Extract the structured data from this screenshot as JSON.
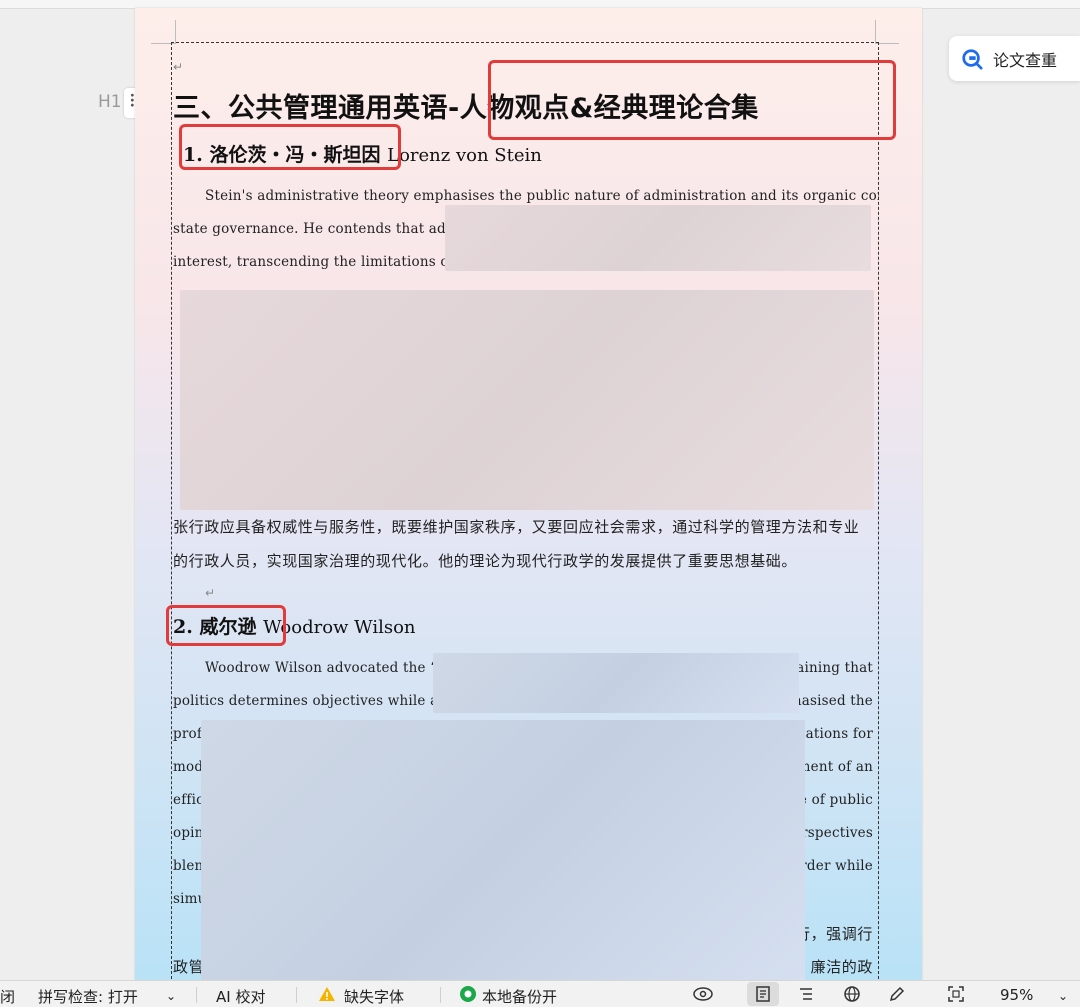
{
  "document": {
    "title": "三、公共管理通用英语-人物观点&经典理论合集",
    "section1": {
      "num": "1.",
      "name_cn": "洛伦茨・冯・斯坦因",
      "name_en": "Lorenz von Stein",
      "lines": [
        "Stein's administrative theory emphasises the public nature of administration and its organic connection to",
        "state governance. He contends that adminis",
        "interest, transcending the limitations of the"
      ],
      "cn_lines": [
        "张行政应具备权威性与服务性，既要维护国家秩序，又要回应社会需求，通过科学的管理方法和专业",
        "的行政人员，实现国家治理的现代化。他的理论为现代行政学的发展提供了重要思想基础。"
      ]
    },
    "section2": {
      "num": "2.",
      "name_cn": "威尔逊",
      "name_en": "Woodrow Wilson",
      "lines_left": [
        "Woodrow Wilson advocated the  ‘s",
        "politics determines objectives while ad",
        "prof",
        "mod",
        "effic",
        "opin",
        "blen",
        "simu"
      ],
      "lines_right": [
        "ntaining that",
        "hasised the",
        "ndations for",
        "ment of an",
        "le of public",
        "erspectives",
        "rder while",
        ""
      ],
      "cn_tail_right": "行，强调行",
      "cn_bottom_left": "政管",
      "cn_bottom_right": "廉洁的政"
    }
  },
  "sidebar": {
    "heading_marker": "H1",
    "check_button": "论文查重"
  },
  "status_bar": {
    "close_fragment": "闭",
    "spell_check": "拼写检查: 打开",
    "ai_proofread": "AI 校对",
    "missing_fonts": "缺失字体",
    "local_backup": "本地备份开",
    "zoom": "95%"
  },
  "colors": {
    "highlight_box": "#e23b3b",
    "accent": "#1e6bf0"
  }
}
